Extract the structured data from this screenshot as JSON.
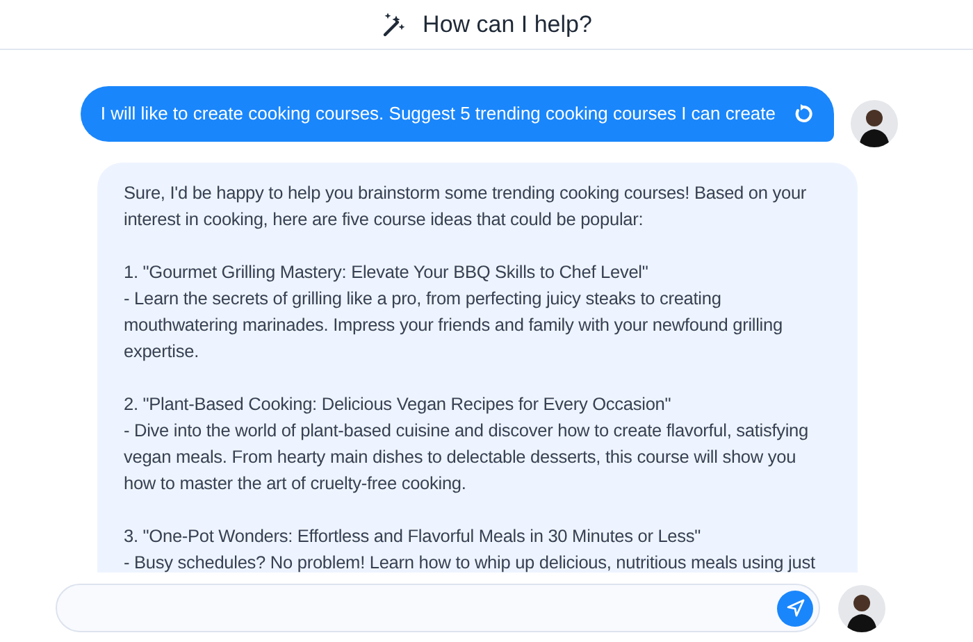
{
  "header": {
    "title": "How can I help?"
  },
  "user_message": {
    "text": "I will like to create cooking courses. Suggest 5 trending cooking courses I can create"
  },
  "reply": {
    "paragraphs": [
      "Sure, I'd be happy to help you brainstorm some trending cooking courses! Based on your interest in cooking, here are five course ideas that could be popular:",
      "1. \"Gourmet Grilling Mastery: Elevate Your BBQ Skills to Chef Level\"\n- Learn the secrets of grilling like a pro, from perfecting juicy steaks to creating mouthwatering marinades. Impress your friends and family with your newfound grilling expertise.",
      "2. \"Plant-Based Cooking: Delicious Vegan Recipes for Every Occasion\"\n- Dive into the world of plant-based cuisine and discover how to create flavorful, satisfying vegan meals. From hearty main dishes to delectable desserts, this course will show you how to master the art of cruelty-free cooking.",
      "3. \"One-Pot Wonders: Effortless and Flavorful Meals in 30 Minutes or Less\"\n- Busy schedules? No problem! Learn how to whip up delicious, nutritious meals using just"
    ]
  }
}
